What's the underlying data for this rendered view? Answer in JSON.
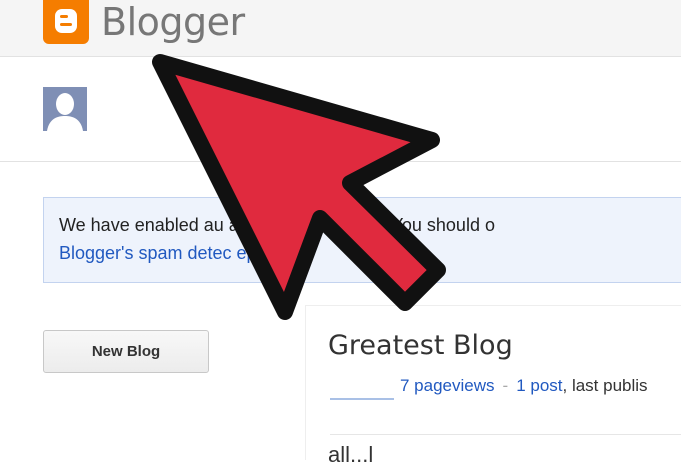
{
  "header": {
    "brand": "Blogger",
    "logo_icon": "blogger-logo-icon",
    "brand_color": "#f57d00"
  },
  "profile": {
    "avatar_icon": "user-silhouette-icon"
  },
  "notice": {
    "line1": "We have enabled au                               ation for comments. You should o",
    "line2": "Blogger's spam detec                  eport"
  },
  "actions": {
    "new_blog_label": "New Blog"
  },
  "blog": {
    "title": "Greatest Blog",
    "pageviews": "7 pageviews",
    "separator": "-",
    "posts": "1 post",
    "last_published": ", last publis",
    "cut_text": "all...l"
  },
  "overlay": {
    "pointer_icon": "red-arrow-pointer-icon",
    "pointer_color": "#e02a3e"
  }
}
